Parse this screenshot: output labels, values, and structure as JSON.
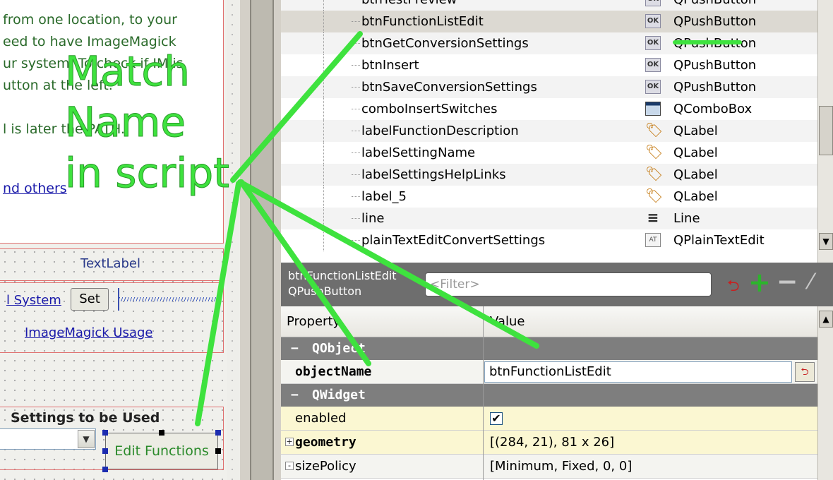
{
  "form_canvas": {
    "help_lines": [
      "from one location, to your",
      "eed to have ImageMagick",
      "ur system. To check if IM is",
      "utton at the left.",
      "",
      "l is later the PATH."
    ],
    "help_link": "nd others",
    "textlabel": "TextLabel",
    "system_link": "l System",
    "set_button": "Set",
    "usage_link": "ImageMagick Usage",
    "settings_title": "Settings to be Used",
    "edit_functions_button": "Edit Functions"
  },
  "object_tree": {
    "rows": [
      {
        "name": "btnTestPreview",
        "class": "QPushButton",
        "icon": "ok-icon",
        "state": "normal"
      },
      {
        "name": "btnFunctionListEdit",
        "class": "QPushButton",
        "icon": "ok-icon",
        "state": "selected"
      },
      {
        "name": "btnGetConversionSettings",
        "class": "QPushButton",
        "icon": "ok-icon",
        "state": "normal"
      },
      {
        "name": "btnInsert",
        "class": "QPushButton",
        "icon": "ok-icon",
        "state": "normal"
      },
      {
        "name": "btnSaveConversionSettings",
        "class": "QPushButton",
        "icon": "ok-icon",
        "state": "normal"
      },
      {
        "name": "comboInsertSwitches",
        "class": "QComboBox",
        "icon": "combobox-icon",
        "state": "normal"
      },
      {
        "name": "labelFunctionDescription",
        "class": "QLabel",
        "icon": "label-icon",
        "state": "normal"
      },
      {
        "name": "labelSettingName",
        "class": "QLabel",
        "icon": "label-icon",
        "state": "normal"
      },
      {
        "name": "labelSettingsHelpLinks",
        "class": "QLabel",
        "icon": "label-icon",
        "state": "normal"
      },
      {
        "name": "label_5",
        "class": "QLabel",
        "icon": "label-icon",
        "state": "normal"
      },
      {
        "name": "line",
        "class": "Line",
        "icon": "line-icon",
        "state": "normal"
      },
      {
        "name": "plainTextEditConvertSettings",
        "class": "QPlainTextEdit",
        "icon": "plaintextedit-icon",
        "state": "normal"
      }
    ]
  },
  "property_editor": {
    "object_name": "btnFunctionListEdit",
    "object_class": "QPushButton",
    "filter_placeholder": "<Filter>",
    "col_property": "Property",
    "col_value": "Value",
    "groups": [
      {
        "name": "QObject",
        "props": [
          {
            "name": "objectName",
            "value": "btnFunctionListEdit",
            "bold": true,
            "editing": true
          }
        ]
      },
      {
        "name": "QWidget",
        "props": [
          {
            "name": "enabled",
            "value": "✔",
            "bold": false,
            "checkbox": true,
            "checked": true
          },
          {
            "name": "geometry",
            "value": "[(284, 21), 81 x 26]",
            "bold": true,
            "expander": "+"
          },
          {
            "name": "sizePolicy",
            "value": "[Minimum, Fixed, 0, 0]",
            "bold": false,
            "expander": "-"
          }
        ]
      }
    ]
  },
  "annotation": {
    "lines": [
      "Match",
      "Name",
      "in script"
    ],
    "color": "#3ee23e"
  },
  "colors": {
    "selection": "#dcd9d2",
    "group_header": "#7e7e7e",
    "row_yellow": "#fbf7d2",
    "link": "#1a1aaa",
    "form_border": "#e07070"
  }
}
